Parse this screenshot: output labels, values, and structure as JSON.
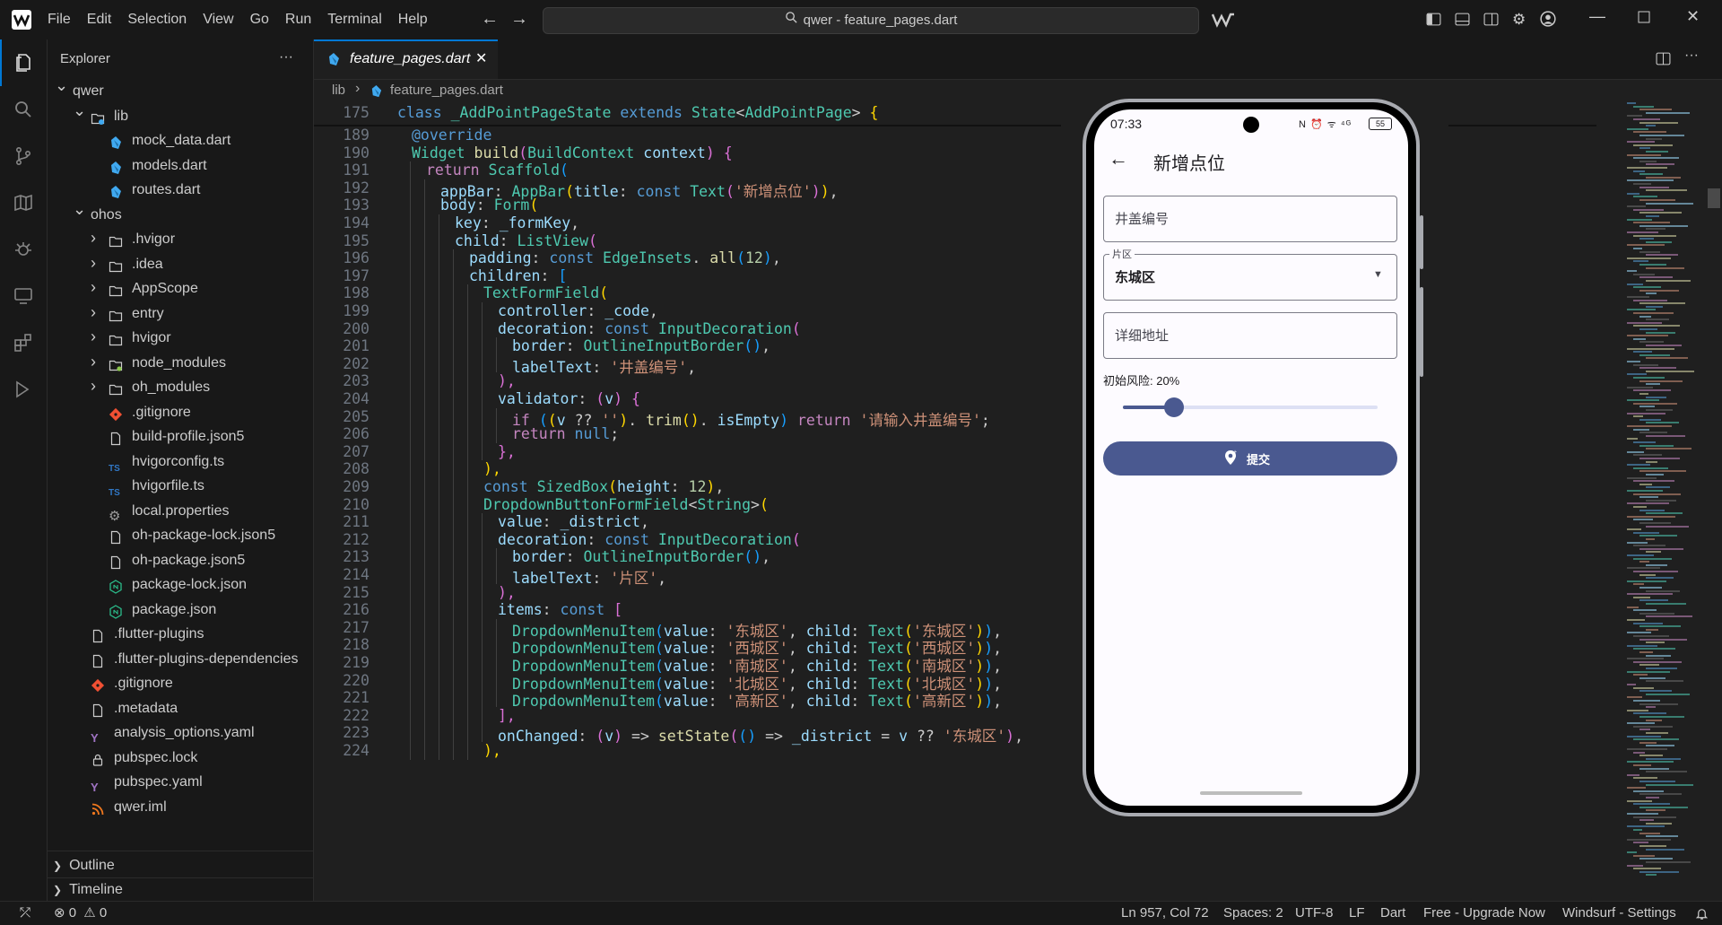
{
  "menu": [
    "File",
    "Edit",
    "Selection",
    "View",
    "Go",
    "Run",
    "Terminal",
    "Help"
  ],
  "command_center": "qwer - feature_pages.dart",
  "sidebar": {
    "title": "Explorer",
    "more": "···",
    "items": [
      {
        "label": "qwer",
        "depth": 0,
        "type": "root",
        "chev": "down"
      },
      {
        "label": "lib",
        "depth": 1,
        "type": "folder-open",
        "chev": "down"
      },
      {
        "label": "mock_data.dart",
        "depth": 2,
        "type": "dart"
      },
      {
        "label": "models.dart",
        "depth": 2,
        "type": "dart"
      },
      {
        "label": "routes.dart",
        "depth": 2,
        "type": "dart"
      },
      {
        "label": "ohos",
        "depth": 1,
        "type": "none",
        "chev": "down"
      },
      {
        "label": ".hvigor",
        "depth": 2,
        "type": "folder",
        "chev": "right"
      },
      {
        "label": ".idea",
        "depth": 2,
        "type": "folder",
        "chev": "right"
      },
      {
        "label": "AppScope",
        "depth": 2,
        "type": "folder",
        "chev": "right"
      },
      {
        "label": "entry",
        "depth": 2,
        "type": "folder",
        "chev": "right"
      },
      {
        "label": "hvigor",
        "depth": 2,
        "type": "folder",
        "chev": "right"
      },
      {
        "label": "node_modules",
        "depth": 2,
        "type": "folder-node",
        "chev": "right"
      },
      {
        "label": "oh_modules",
        "depth": 2,
        "type": "folder",
        "chev": "right"
      },
      {
        "label": ".gitignore",
        "depth": 2,
        "type": "git"
      },
      {
        "label": "build-profile.json5",
        "depth": 2,
        "type": "file"
      },
      {
        "label": "hvigorconfig.ts",
        "depth": 2,
        "type": "ts"
      },
      {
        "label": "hvigorfile.ts",
        "depth": 2,
        "type": "ts"
      },
      {
        "label": "local.properties",
        "depth": 2,
        "type": "gear"
      },
      {
        "label": "oh-package-lock.json5",
        "depth": 2,
        "type": "file"
      },
      {
        "label": "oh-package.json5",
        "depth": 2,
        "type": "file"
      },
      {
        "label": "package-lock.json",
        "depth": 2,
        "type": "npm"
      },
      {
        "label": "package.json",
        "depth": 2,
        "type": "npm"
      },
      {
        "label": ".flutter-plugins",
        "depth": 1,
        "type": "file"
      },
      {
        "label": ".flutter-plugins-dependencies",
        "depth": 1,
        "type": "file"
      },
      {
        "label": ".gitignore",
        "depth": 1,
        "type": "git"
      },
      {
        "label": ".metadata",
        "depth": 1,
        "type": "file"
      },
      {
        "label": "analysis_options.yaml",
        "depth": 1,
        "type": "yaml"
      },
      {
        "label": "pubspec.lock",
        "depth": 1,
        "type": "lock"
      },
      {
        "label": "pubspec.yaml",
        "depth": 1,
        "type": "yaml"
      },
      {
        "label": "qwer.iml",
        "depth": 1,
        "type": "rss"
      }
    ],
    "ts_badge": "TS",
    "yaml_badge": "Y",
    "outline": "Outline",
    "timeline": "Timeline"
  },
  "editor": {
    "tab_label": "feature_pages.dart",
    "tab_close": "✕",
    "breadcrumb_root": "lib",
    "breadcrumb_sep": "›",
    "breadcrumb_file": "feature_pages.dart"
  },
  "code_lines": [
    {
      "n": "175",
      "sticky": true,
      "i": 0,
      "tokens": [
        [
          "k",
          "class "
        ],
        [
          "t",
          "_AddPointPageState "
        ],
        [
          "k",
          "extends "
        ],
        [
          "t",
          "State"
        ],
        [
          "",
          "<"
        ],
        [
          "t",
          "AddPointPage"
        ],
        [
          "",
          "> "
        ],
        [
          "y",
          "{"
        ]
      ]
    },
    {
      "n": "189",
      "i": 1,
      "tokens": [
        [
          "k",
          "@override"
        ]
      ]
    },
    {
      "n": "190",
      "i": 1,
      "tokens": [
        [
          "t",
          "Widget "
        ],
        [
          "f",
          "build"
        ],
        [
          "g",
          "("
        ],
        [
          "t",
          "BuildContext "
        ],
        [
          "p",
          "context"
        ],
        [
          "g",
          ")"
        ],
        [
          "",
          ""
        ],
        [
          "g",
          " {"
        ]
      ]
    },
    {
      "n": "191",
      "i": 2,
      "tokens": [
        [
          "c",
          "return "
        ],
        [
          "t",
          "Scaffold"
        ],
        [
          "b",
          "("
        ]
      ]
    },
    {
      "n": "192",
      "i": 3,
      "tokens": [
        [
          "p",
          "appBar"
        ],
        [
          "",
          ": "
        ],
        [
          "t",
          "AppBar"
        ],
        [
          "y",
          "("
        ],
        [
          "p",
          "title"
        ],
        [
          "",
          ": "
        ],
        [
          "k",
          "const "
        ],
        [
          "t",
          "Text"
        ],
        [
          "g",
          "("
        ],
        [
          "s",
          "'新增点位'"
        ],
        [
          "g",
          ")"
        ],
        [
          "y",
          ")"
        ],
        [
          "",
          ","
        ]
      ]
    },
    {
      "n": "193",
      "i": 3,
      "tokens": [
        [
          "p",
          "body"
        ],
        [
          "",
          ": "
        ],
        [
          "t",
          "Form"
        ],
        [
          "y",
          "("
        ]
      ]
    },
    {
      "n": "194",
      "i": 4,
      "tokens": [
        [
          "p",
          "key"
        ],
        [
          "",
          ": "
        ],
        [
          "p",
          "_formKey"
        ],
        [
          "",
          ","
        ]
      ]
    },
    {
      "n": "195",
      "i": 4,
      "tokens": [
        [
          "p",
          "child"
        ],
        [
          "",
          ": "
        ],
        [
          "t",
          "ListView"
        ],
        [
          "g",
          "("
        ]
      ]
    },
    {
      "n": "196",
      "i": 5,
      "tokens": [
        [
          "p",
          "padding"
        ],
        [
          "",
          ": "
        ],
        [
          "k",
          "const "
        ],
        [
          "t",
          "EdgeInsets"
        ],
        [
          "",
          ". "
        ],
        [
          "f",
          "all"
        ],
        [
          "b",
          "("
        ],
        [
          "n",
          "12"
        ],
        [
          "b",
          ")"
        ],
        [
          "",
          ","
        ]
      ]
    },
    {
      "n": "197",
      "i": 5,
      "tokens": [
        [
          "p",
          "children"
        ],
        [
          "",
          ": "
        ],
        [
          "b",
          "["
        ]
      ]
    },
    {
      "n": "198",
      "i": 6,
      "tokens": [
        [
          "t",
          "TextFormField"
        ],
        [
          "y",
          "("
        ]
      ]
    },
    {
      "n": "199",
      "i": 7,
      "tokens": [
        [
          "p",
          "controller"
        ],
        [
          "",
          ": "
        ],
        [
          "p",
          "_code"
        ],
        [
          "",
          ","
        ]
      ]
    },
    {
      "n": "200",
      "i": 7,
      "tokens": [
        [
          "p",
          "decoration"
        ],
        [
          "",
          ": "
        ],
        [
          "k",
          "const "
        ],
        [
          "t",
          "InputDecoration"
        ],
        [
          "g",
          "("
        ]
      ]
    },
    {
      "n": "201",
      "i": 8,
      "tokens": [
        [
          "p",
          "border"
        ],
        [
          "",
          ": "
        ],
        [
          "t",
          "OutlineInputBorder"
        ],
        [
          "b",
          "()"
        ],
        [
          "",
          ","
        ]
      ]
    },
    {
      "n": "202",
      "i": 8,
      "tokens": [
        [
          "p",
          "labelText"
        ],
        [
          "",
          ": "
        ],
        [
          "s",
          "'井盖编号'"
        ],
        [
          "",
          ","
        ]
      ]
    },
    {
      "n": "203",
      "i": 7,
      "tokens": [
        [
          "g",
          "),"
        ]
      ]
    },
    {
      "n": "204",
      "i": 7,
      "tokens": [
        [
          "p",
          "validator"
        ],
        [
          "",
          ": "
        ],
        [
          "g",
          "("
        ],
        [
          "p",
          "v"
        ],
        [
          "g",
          ")"
        ],
        [
          "g",
          " {"
        ]
      ]
    },
    {
      "n": "205",
      "i": 8,
      "tokens": [
        [
          "c",
          "if "
        ],
        [
          "b",
          "("
        ],
        [
          "y",
          "("
        ],
        [
          "p",
          "v "
        ],
        [
          "",
          "?? "
        ],
        [
          "s",
          "''"
        ],
        [
          "y",
          ")"
        ],
        [
          "",
          ". "
        ],
        [
          "f",
          "trim"
        ],
        [
          "y",
          "()"
        ],
        [
          "",
          ". "
        ],
        [
          "p",
          "isEmpty"
        ],
        [
          "b",
          ") "
        ],
        [
          "c",
          "return "
        ],
        [
          "s",
          "'请输入井盖编号'"
        ],
        [
          "",
          ";"
        ]
      ]
    },
    {
      "n": "206",
      "i": 8,
      "tokens": [
        [
          "c",
          "return "
        ],
        [
          "k",
          "null"
        ],
        [
          "",
          ";"
        ]
      ]
    },
    {
      "n": "207",
      "i": 7,
      "tokens": [
        [
          "g",
          "},"
        ]
      ]
    },
    {
      "n": "208",
      "i": 6,
      "tokens": [
        [
          "y",
          "),"
        ]
      ]
    },
    {
      "n": "209",
      "i": 6,
      "tokens": [
        [
          "k",
          "const "
        ],
        [
          "t",
          "SizedBox"
        ],
        [
          "y",
          "("
        ],
        [
          "p",
          "height"
        ],
        [
          "",
          ": "
        ],
        [
          "n",
          "12"
        ],
        [
          "y",
          ")"
        ],
        [
          "",
          ","
        ]
      ]
    },
    {
      "n": "210",
      "i": 6,
      "tokens": [
        [
          "t",
          "DropdownButtonFormField"
        ],
        [
          "",
          "<"
        ],
        [
          "t",
          "String"
        ],
        [
          "",
          ">"
        ],
        [
          "y",
          "("
        ]
      ]
    },
    {
      "n": "211",
      "i": 7,
      "tokens": [
        [
          "p",
          "value"
        ],
        [
          "",
          ": "
        ],
        [
          "p",
          "_district"
        ],
        [
          "",
          ","
        ]
      ]
    },
    {
      "n": "212",
      "i": 7,
      "tokens": [
        [
          "p",
          "decoration"
        ],
        [
          "",
          ": "
        ],
        [
          "k",
          "const "
        ],
        [
          "t",
          "InputDecoration"
        ],
        [
          "g",
          "("
        ]
      ]
    },
    {
      "n": "213",
      "i": 8,
      "tokens": [
        [
          "p",
          "border"
        ],
        [
          "",
          ": "
        ],
        [
          "t",
          "OutlineInputBorder"
        ],
        [
          "b",
          "()"
        ],
        [
          "",
          ","
        ]
      ]
    },
    {
      "n": "214",
      "i": 8,
      "tokens": [
        [
          "p",
          "labelText"
        ],
        [
          "",
          ": "
        ],
        [
          "s",
          "'片区'"
        ],
        [
          "",
          ","
        ]
      ]
    },
    {
      "n": "215",
      "i": 7,
      "tokens": [
        [
          "g",
          "),"
        ]
      ]
    },
    {
      "n": "216",
      "i": 7,
      "tokens": [
        [
          "p",
          "items"
        ],
        [
          "",
          ": "
        ],
        [
          "k",
          "const "
        ],
        [
          "g",
          "["
        ]
      ]
    },
    {
      "n": "217",
      "i": 8,
      "tokens": [
        [
          "t",
          "DropdownMenuItem"
        ],
        [
          "b",
          "("
        ],
        [
          "p",
          "value"
        ],
        [
          "",
          ": "
        ],
        [
          "s",
          "'东城区'"
        ],
        [
          "",
          ", "
        ],
        [
          "p",
          "child"
        ],
        [
          "",
          ": "
        ],
        [
          "t",
          "Text"
        ],
        [
          "y",
          "("
        ],
        [
          "s",
          "'东城区'"
        ],
        [
          "y",
          ")"
        ],
        [
          "b",
          ")"
        ],
        [
          "",
          ","
        ]
      ]
    },
    {
      "n": "218",
      "i": 8,
      "tokens": [
        [
          "t",
          "DropdownMenuItem"
        ],
        [
          "b",
          "("
        ],
        [
          "p",
          "value"
        ],
        [
          "",
          ": "
        ],
        [
          "s",
          "'西城区'"
        ],
        [
          "",
          ", "
        ],
        [
          "p",
          "child"
        ],
        [
          "",
          ": "
        ],
        [
          "t",
          "Text"
        ],
        [
          "y",
          "("
        ],
        [
          "s",
          "'西城区'"
        ],
        [
          "y",
          ")"
        ],
        [
          "b",
          ")"
        ],
        [
          "",
          ","
        ]
      ]
    },
    {
      "n": "219",
      "i": 8,
      "tokens": [
        [
          "t",
          "DropdownMenuItem"
        ],
        [
          "b",
          "("
        ],
        [
          "p",
          "value"
        ],
        [
          "",
          ": "
        ],
        [
          "s",
          "'南城区'"
        ],
        [
          "",
          ", "
        ],
        [
          "p",
          "child"
        ],
        [
          "",
          ": "
        ],
        [
          "t",
          "Text"
        ],
        [
          "y",
          "("
        ],
        [
          "s",
          "'南城区'"
        ],
        [
          "y",
          ")"
        ],
        [
          "b",
          ")"
        ],
        [
          "",
          ","
        ]
      ]
    },
    {
      "n": "220",
      "i": 8,
      "tokens": [
        [
          "t",
          "DropdownMenuItem"
        ],
        [
          "b",
          "("
        ],
        [
          "p",
          "value"
        ],
        [
          "",
          ": "
        ],
        [
          "s",
          "'北城区'"
        ],
        [
          "",
          ", "
        ],
        [
          "p",
          "child"
        ],
        [
          "",
          ": "
        ],
        [
          "t",
          "Text"
        ],
        [
          "y",
          "("
        ],
        [
          "s",
          "'北城区'"
        ],
        [
          "y",
          ")"
        ],
        [
          "b",
          ")"
        ],
        [
          "",
          ","
        ]
      ]
    },
    {
      "n": "221",
      "i": 8,
      "tokens": [
        [
          "t",
          "DropdownMenuItem"
        ],
        [
          "b",
          "("
        ],
        [
          "p",
          "value"
        ],
        [
          "",
          ": "
        ],
        [
          "s",
          "'高新区'"
        ],
        [
          "",
          ", "
        ],
        [
          "p",
          "child"
        ],
        [
          "",
          ": "
        ],
        [
          "t",
          "Text"
        ],
        [
          "y",
          "("
        ],
        [
          "s",
          "'高新区'"
        ],
        [
          "y",
          ")"
        ],
        [
          "b",
          ")"
        ],
        [
          "",
          ","
        ]
      ]
    },
    {
      "n": "222",
      "i": 7,
      "tokens": [
        [
          "g",
          "],"
        ]
      ]
    },
    {
      "n": "223",
      "i": 7,
      "tokens": [
        [
          "p",
          "onChanged"
        ],
        [
          "",
          ": "
        ],
        [
          "g",
          "("
        ],
        [
          "p",
          "v"
        ],
        [
          "g",
          ") "
        ],
        [
          "",
          "=> "
        ],
        [
          "f",
          "setState"
        ],
        [
          "g",
          "("
        ],
        [
          "b",
          "() "
        ],
        [
          "",
          "=> "
        ],
        [
          "p",
          "_district "
        ],
        [
          "",
          "= "
        ],
        [
          "p",
          "v "
        ],
        [
          "",
          "?? "
        ],
        [
          "s",
          "'东城区'"
        ],
        [
          "g",
          ")"
        ],
        [
          "",
          ","
        ]
      ]
    },
    {
      "n": "224",
      "i": 6,
      "tokens": [
        [
          "y",
          "),"
        ]
      ]
    }
  ],
  "phone": {
    "time": "07:33",
    "status_icons": "N ⏰ ᯤ ⁴ᴳ",
    "battery": "55",
    "app_title": "新增点位",
    "field_code_placeholder": "井盖编号",
    "district_label": "片区",
    "district_value": "东城区",
    "address_placeholder": "详细地址",
    "risk_label": "初始风险: 20%",
    "risk_value": 0.2,
    "submit_label": "提交"
  },
  "status": {
    "problems_errors": "0",
    "problems_warnings": "0",
    "position": "Ln 957, Col 72",
    "spaces": "Spaces: 2",
    "encoding": "UTF-8",
    "eol": "LF",
    "language": "Dart",
    "upgrade": "Free - Upgrade Now",
    "settings": "Windsurf - Settings"
  },
  "colors": {
    "accent": "#0078d4",
    "phone_primary": "#4a5990",
    "dart": "#40a9f0"
  }
}
